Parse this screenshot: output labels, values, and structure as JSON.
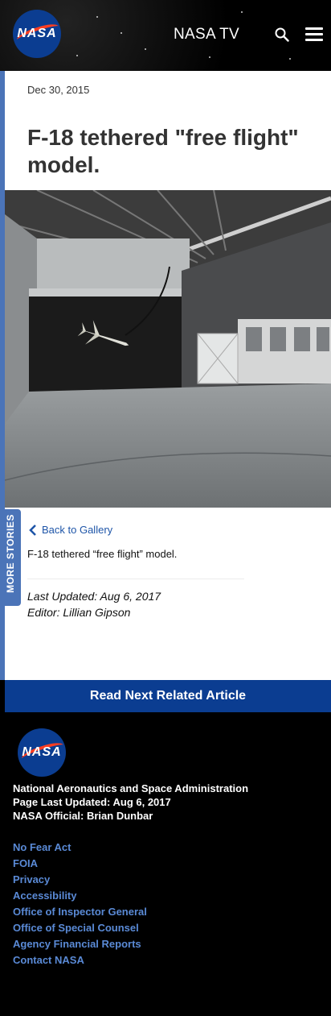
{
  "header": {
    "logo_text": "NASA",
    "nav_title": "NASA TV",
    "search_icon": "search-icon",
    "menu_icon": "hamburger-menu-icon"
  },
  "article": {
    "date": "Dec 30, 2015",
    "title": "F-18 tethered \"free flight\" model.",
    "image_alt": "F-18 tethered free flight model in wind tunnel",
    "back_link": "Back to Gallery",
    "caption": "F-18 tethered “free flight” model.",
    "last_updated": "Last Updated: Aug 6, 2017",
    "editor": "Editor: Lillian Gipson"
  },
  "side_tab": {
    "label": "MORE STORIES"
  },
  "read_next": {
    "label": "Read Next Related Article"
  },
  "footer": {
    "logo_text": "NASA",
    "agency": "National Aeronautics and Space Administration",
    "page_updated": "Page Last Updated: Aug 6, 2017",
    "official": "NASA Official: Brian Dunbar",
    "links": [
      "No Fear Act",
      "FOIA",
      "Privacy",
      "Accessibility",
      "Office of Inspector General",
      "Office of Special Counsel",
      "Agency Financial Reports",
      "Contact NASA"
    ]
  },
  "colors": {
    "nasa_blue": "#0b3d91",
    "side_blue": "#4b74b8",
    "link_blue": "#5a8ad6",
    "nasa_red": "#fc3d21"
  }
}
